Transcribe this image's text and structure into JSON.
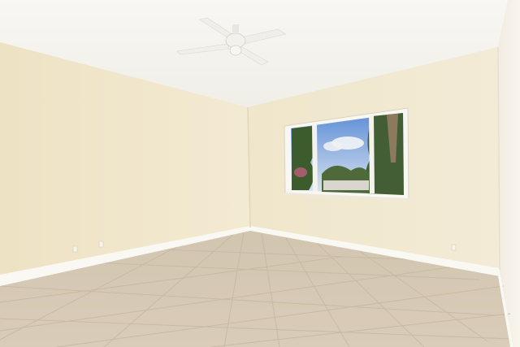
{
  "scene": {
    "subject": "empty room",
    "colors": {
      "ceiling": "#f6f4ee",
      "left_wall": "#efe4c8",
      "back_wall": "#f1e8cf",
      "right_wall": "#f4efe2",
      "floor": "#d6c8b3",
      "baseboard": "#fbfaf6",
      "window_frame": "#f7f6f1",
      "sky": "#7fa7df",
      "foliage": "#3f5a32"
    }
  }
}
